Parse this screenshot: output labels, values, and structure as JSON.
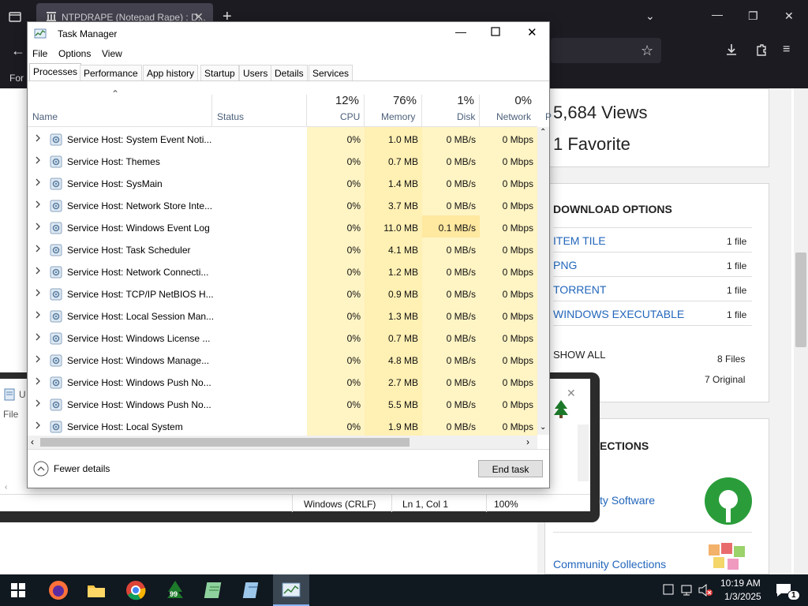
{
  "browser": {
    "tab_title": "NTPDRAPE (Notepad Rape) : D...",
    "new_tab_label": "+",
    "left_text": "For"
  },
  "archive": {
    "views": "5,684 Views",
    "favorites": "1 Favorite",
    "download_heading": "DOWNLOAD OPTIONS",
    "downloads": [
      {
        "label": "ITEM TILE",
        "count": "1 file"
      },
      {
        "label": "PNG",
        "count": "1 file"
      },
      {
        "label": "TORRENT",
        "count": "1 file"
      },
      {
        "label": "WINDOWS EXECUTABLE",
        "count": "1 file"
      }
    ],
    "show_all": "SHOW ALL",
    "files_total": "8 Files",
    "original_total": "7 Original",
    "collections_heading": "ECTIONS",
    "collection_1": "ty Software",
    "collection_2": "Community Collections"
  },
  "notepad": {
    "title_fragment": "U",
    "menu_file": "File",
    "encoding": "Windows (CRLF)",
    "position": "Ln 1, Col 1",
    "zoom": "100%"
  },
  "taskmanager": {
    "title": "Task Manager",
    "menu": [
      "File",
      "Options",
      "View"
    ],
    "tabs": [
      "Processes",
      "Performance",
      "App history",
      "Startup",
      "Users",
      "Details",
      "Services"
    ],
    "header": {
      "name": "Name",
      "status": "Status",
      "cpu_pct": "12%",
      "cpu": "CPU",
      "mem_pct": "76%",
      "mem": "Memory",
      "disk_pct": "1%",
      "disk": "Disk",
      "net_pct": "0%",
      "net": "Network",
      "power_frag": "P"
    },
    "processes": [
      {
        "name": "Service Host: System Event Noti...",
        "cpu": "0%",
        "mem": "1.0 MB",
        "disk": "0 MB/s",
        "net": "0 Mbps"
      },
      {
        "name": "Service Host: Themes",
        "cpu": "0%",
        "mem": "0.7 MB",
        "disk": "0 MB/s",
        "net": "0 Mbps"
      },
      {
        "name": "Service Host: SysMain",
        "cpu": "0%",
        "mem": "1.4 MB",
        "disk": "0 MB/s",
        "net": "0 Mbps"
      },
      {
        "name": "Service Host: Network Store Inte...",
        "cpu": "0%",
        "mem": "3.7 MB",
        "disk": "0 MB/s",
        "net": "0 Mbps"
      },
      {
        "name": "Service Host: Windows Event Log",
        "cpu": "0%",
        "mem": "11.0 MB",
        "disk": "0.1 MB/s",
        "net": "0 Mbps"
      },
      {
        "name": "Service Host: Task Scheduler",
        "cpu": "0%",
        "mem": "4.1 MB",
        "disk": "0 MB/s",
        "net": "0 Mbps"
      },
      {
        "name": "Service Host: Network Connecti...",
        "cpu": "0%",
        "mem": "1.2 MB",
        "disk": "0 MB/s",
        "net": "0 Mbps"
      },
      {
        "name": "Service Host: TCP/IP NetBIOS H...",
        "cpu": "0%",
        "mem": "0.9 MB",
        "disk": "0 MB/s",
        "net": "0 Mbps"
      },
      {
        "name": "Service Host: Local Session Man...",
        "cpu": "0%",
        "mem": "1.3 MB",
        "disk": "0 MB/s",
        "net": "0 Mbps"
      },
      {
        "name": "Service Host: Windows License ...",
        "cpu": "0%",
        "mem": "0.7 MB",
        "disk": "0 MB/s",
        "net": "0 Mbps"
      },
      {
        "name": "Service Host: Windows Manage...",
        "cpu": "0%",
        "mem": "4.8 MB",
        "disk": "0 MB/s",
        "net": "0 Mbps"
      },
      {
        "name": "Service Host: Windows Push No...",
        "cpu": "0%",
        "mem": "2.7 MB",
        "disk": "0 MB/s",
        "net": "0 Mbps"
      },
      {
        "name": "Service Host: Windows Push No...",
        "cpu": "0%",
        "mem": "5.5 MB",
        "disk": "0 MB/s",
        "net": "0 Mbps"
      },
      {
        "name": "Service Host: Local System",
        "cpu": "0%",
        "mem": "1.9 MB",
        "disk": "0 MB/s",
        "net": "0 Mbps"
      }
    ],
    "fewer_details": "Fewer details",
    "end_task": "End task"
  },
  "taskbar": {
    "time": "10:19 AM",
    "date": "1/3/2025",
    "notification_count": "1",
    "badge_99": "99"
  },
  "colors": {
    "cpu_bg": "#fff4c4",
    "mem_bg": "#fff0b3",
    "disk_hot": "#ffe8a0",
    "link": "#2266bb",
    "taskbar": "#101820"
  }
}
